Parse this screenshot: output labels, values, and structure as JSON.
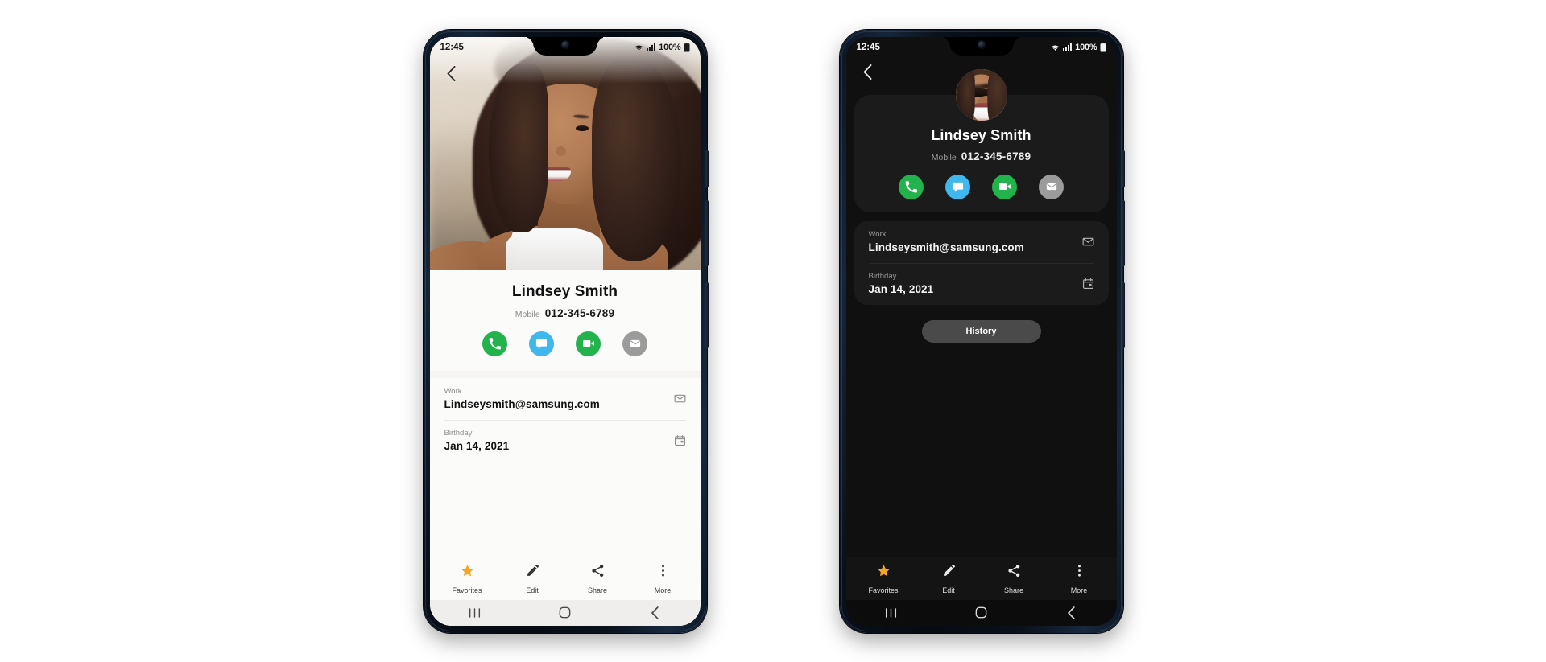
{
  "page": {
    "background": "#ffffff",
    "title": "Samsung Contacts — light and dark mode contact detail screens"
  },
  "colors": {
    "call_green": "#22b34d",
    "message_blue": "#3fb8ed",
    "video_green": "#22b34d",
    "email_gray": "#9b9b9b",
    "favorites_star": "#f5a623",
    "light_bg": "#fbfbfa",
    "dark_bg": "#101010",
    "dark_card": "#1b1b1b",
    "history_btn": "#4a4a4a"
  },
  "status_bar": {
    "time": "12:45",
    "battery_percent": "100%",
    "icons": [
      "wifi-icon",
      "cellular-signal-icon",
      "battery-icon"
    ]
  },
  "contact": {
    "name": "Lindsey Smith",
    "phone_label": "Mobile",
    "phone_number": "012-345-6789",
    "actions": [
      {
        "name": "call",
        "icon": "phone-icon",
        "color": "#22b34d"
      },
      {
        "name": "message",
        "icon": "message-icon",
        "color": "#3fb8ed"
      },
      {
        "name": "video-call",
        "icon": "video-camera-icon",
        "color": "#22b34d"
      },
      {
        "name": "email",
        "icon": "envelope-icon",
        "color": "#9b9b9b"
      }
    ],
    "fields": [
      {
        "label": "Work",
        "value": "Lindseysmith@samsung.com",
        "icon": "envelope-icon"
      },
      {
        "label": "Birthday",
        "value": "Jan 14, 2021",
        "icon": "calendar-icon"
      }
    ]
  },
  "toolbar": {
    "items": [
      {
        "label": "Favorites",
        "icon": "star-icon"
      },
      {
        "label": "Edit",
        "icon": "pencil-icon"
      },
      {
        "label": "Share",
        "icon": "share-icon"
      },
      {
        "label": "More",
        "icon": "overflow-dots-icon"
      }
    ]
  },
  "nav_bar": {
    "items": [
      {
        "name": "recents",
        "icon": "recents-icon"
      },
      {
        "name": "home",
        "icon": "home-icon"
      },
      {
        "name": "back",
        "icon": "back-icon"
      }
    ]
  },
  "dark_screen": {
    "history_label": "History"
  },
  "back_button": {
    "icon": "chevron-left-icon"
  }
}
